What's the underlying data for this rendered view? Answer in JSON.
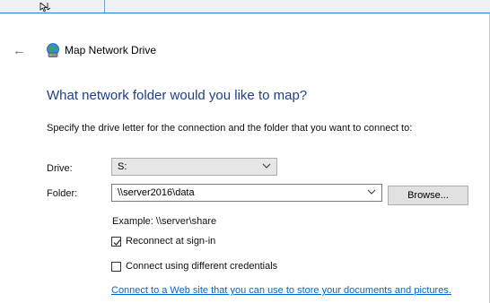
{
  "wizard": {
    "back_label": "←",
    "title": "Map Network Drive"
  },
  "main": {
    "heading": "What network folder would you like to map?",
    "instruction": "Specify the drive letter for the connection and the folder that you want to connect to:",
    "drive": {
      "label": "Drive:",
      "value": "S:"
    },
    "folder": {
      "label": "Folder:",
      "value": "\\\\server2016\\data",
      "browse_label": "Browse..."
    },
    "example": "Example: \\\\server\\share",
    "reconnect": {
      "label": "Reconnect at sign-in",
      "checked": true
    },
    "different_credentials": {
      "label": "Connect using different credentials",
      "checked": false
    },
    "web_link": "Connect to a Web site that you can use to store your documents and pictures."
  },
  "colors": {
    "heading": "#1e3f8c",
    "link": "#0066cc",
    "accent_line": "#2b7bd6"
  },
  "icons": [
    "mouse-cursor-icon",
    "back-arrow-icon",
    "network-drive-icon",
    "chevron-down-icon",
    "checkmark-icon"
  ]
}
